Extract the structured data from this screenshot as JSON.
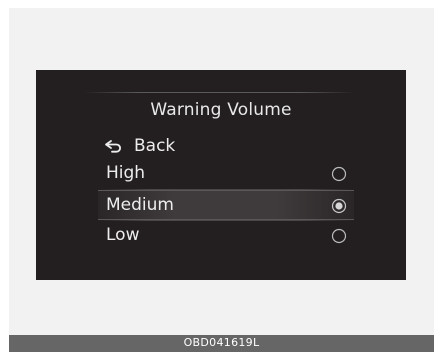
{
  "screen": {
    "title": "Warning Volume",
    "back_label": "Back",
    "back_icon": "back-arrow-icon",
    "options": [
      {
        "label": "High",
        "selected": false
      },
      {
        "label": "Medium",
        "selected": true
      },
      {
        "label": "Low",
        "selected": false
      }
    ]
  },
  "caption": {
    "code": "OBD041619L"
  },
  "colors": {
    "screen_background": "#231f20",
    "text": "#ededed",
    "caption_bar": "#666666"
  }
}
